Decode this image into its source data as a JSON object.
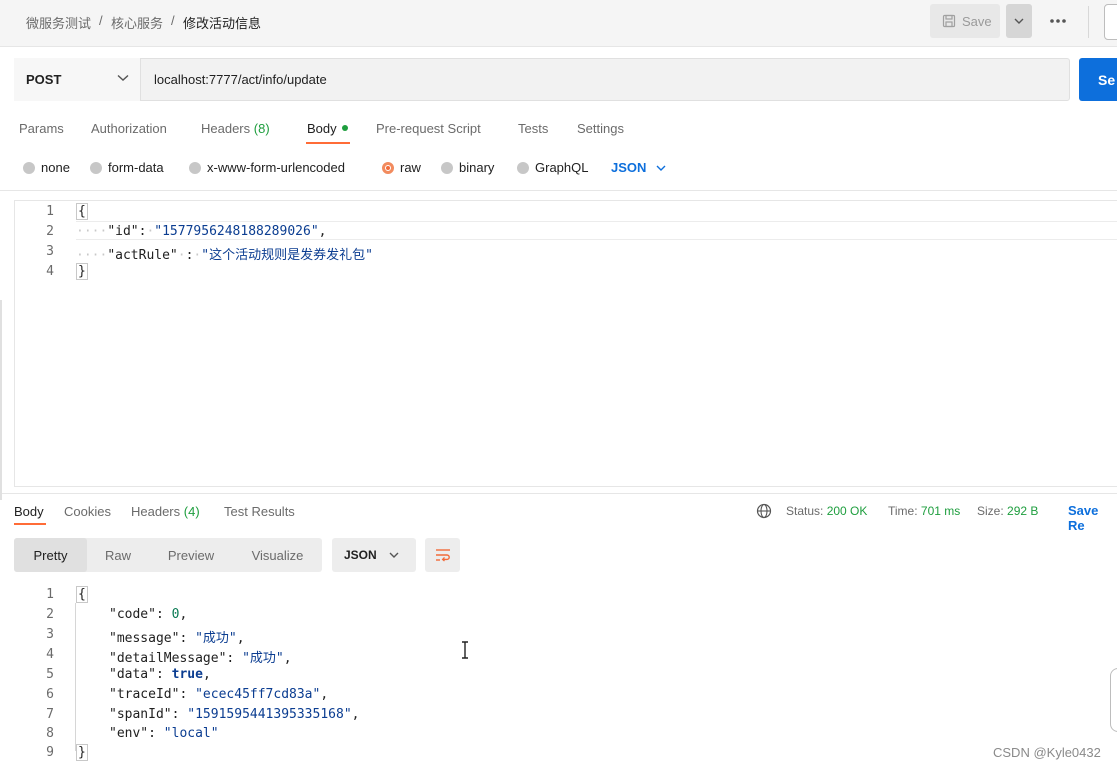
{
  "breadcrumb": {
    "items": [
      "微服务测试",
      "核心服务",
      "修改活动信息"
    ],
    "separator": "/"
  },
  "toolbar": {
    "save_label": "Save"
  },
  "request": {
    "method": "POST",
    "url": "localhost:7777/act/info/update",
    "send_label": "Se"
  },
  "request_tabs": {
    "params": "Params",
    "authorization": "Authorization",
    "headers": "Headers",
    "headers_count": "(8)",
    "body": "Body",
    "prerequest": "Pre-request Script",
    "tests": "Tests",
    "settings": "Settings"
  },
  "body_types": {
    "none": "none",
    "form_data": "form-data",
    "urlencoded": "x-www-form-urlencoded",
    "raw": "raw",
    "binary": "binary",
    "graphql": "GraphQL",
    "format": "JSON"
  },
  "request_body": {
    "line_numbers": [
      "1",
      "2",
      "3",
      "4"
    ],
    "open": "{",
    "close": "}",
    "id_key": "\"id\"",
    "id_value": "\"1577956248188289026\"",
    "actrule_key": "\"actRule\"",
    "actrule_value": "\"这个活动规则是发券发礼包\""
  },
  "response_tabs": {
    "body": "Body",
    "cookies": "Cookies",
    "headers": "Headers",
    "headers_count": "(4)",
    "test_results": "Test Results"
  },
  "response_status": {
    "status_label": "Status:",
    "status_value": "200 OK",
    "time_label": "Time:",
    "time_value": "701 ms",
    "size_label": "Size:",
    "size_value": "292 B",
    "save_response": "Save Re"
  },
  "response_view": {
    "pretty": "Pretty",
    "raw": "Raw",
    "preview": "Preview",
    "visualize": "Visualize",
    "format": "JSON"
  },
  "response_body": {
    "line_numbers": [
      "1",
      "2",
      "3",
      "4",
      "5",
      "6",
      "7",
      "8",
      "9"
    ],
    "open": "{",
    "close": "}",
    "code_key": "\"code\"",
    "code_value": "0",
    "message_key": "\"message\"",
    "message_value": "\"成功\"",
    "detail_key": "\"detailMessage\"",
    "detail_value": "\"成功\"",
    "data_key": "\"data\"",
    "data_value": "true",
    "traceid_key": "\"traceId\"",
    "traceid_value": "\"ecec45ff7cd83a\"",
    "spanid_key": "\"spanId\"",
    "spanid_value": "\"1591595441395335168\"",
    "env_key": "\"env\"",
    "env_value": "\"local\""
  },
  "watermark": "CSDN @Kyle0432",
  "colors": {
    "accent_orange": "#ff6c37",
    "send_blue": "#0d6fdc",
    "status_green": "#1e9e3e"
  }
}
